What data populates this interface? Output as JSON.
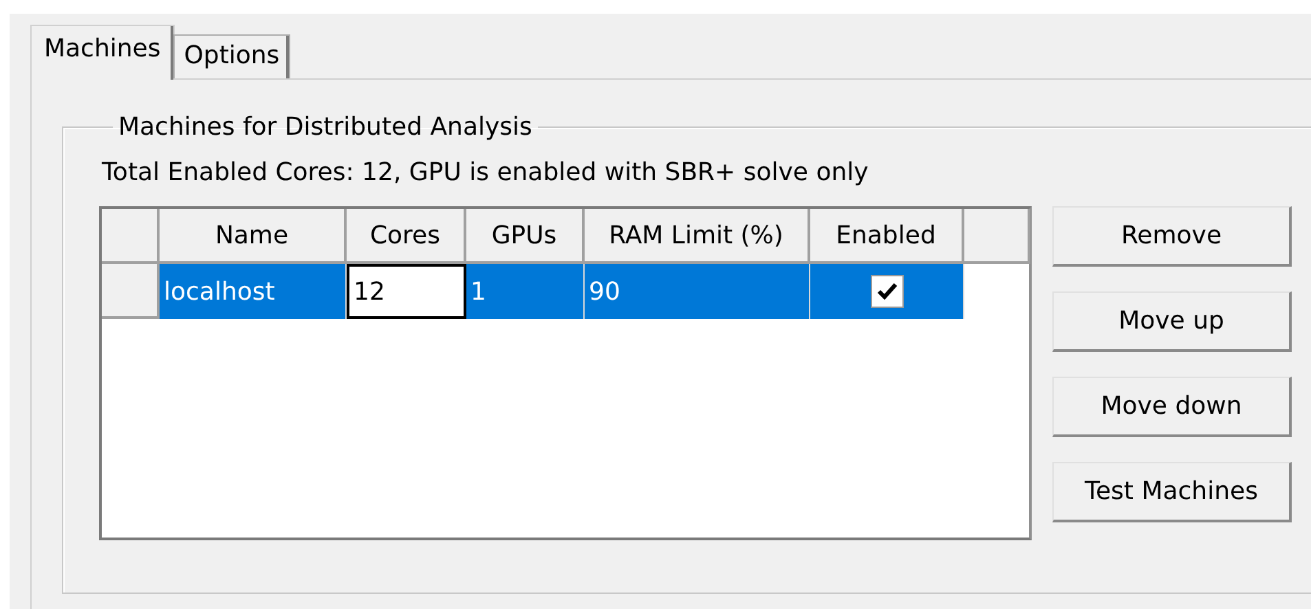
{
  "tabs": [
    {
      "label": "Machines",
      "selected": true
    },
    {
      "label": "Options",
      "selected": false
    }
  ],
  "group": {
    "title": "Machines for Distributed Analysis",
    "summary": "Total Enabled Cores: 12, GPU is enabled with SBR+ solve only"
  },
  "table": {
    "columns": [
      "Name",
      "Cores",
      "GPUs",
      "RAM Limit (%)",
      "Enabled"
    ],
    "rows": [
      {
        "selected": true,
        "cells": [
          {
            "text": "localhost",
            "editing": false
          },
          {
            "text": "12",
            "editing": true
          },
          {
            "text": "1",
            "editing": false
          },
          {
            "text": "90",
            "editing": false
          }
        ],
        "enabled": true
      }
    ]
  },
  "buttons": [
    "Remove",
    "Move up",
    "Move down",
    "Test Machines"
  ]
}
